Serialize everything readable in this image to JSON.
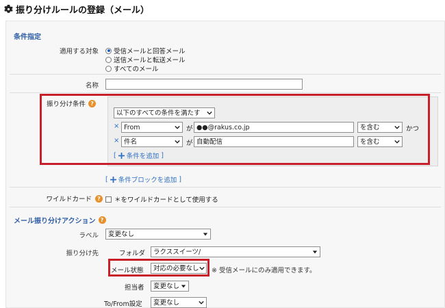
{
  "page": {
    "title": "振り分けルールの登録（メール）"
  },
  "sections": {
    "conditions": "条件指定",
    "actions": "メール振り分けアクション"
  },
  "target": {
    "label": "適用する対象",
    "options": [
      {
        "label": "受信メールと回答メール",
        "selected": true
      },
      {
        "label": "送信メールと転送メール",
        "selected": false
      },
      {
        "label": "すべてのメール",
        "selected": false
      }
    ]
  },
  "name": {
    "label": "名称",
    "value": ""
  },
  "rule": {
    "label": "振り分け条件",
    "match_select": "以下のすべての条件を満たす",
    "rows": [
      {
        "x": "×",
        "field": "From",
        "ga": "が",
        "value": "●●@rakus.co.jp",
        "op": "を含む",
        "join": "かつ"
      },
      {
        "x": "×",
        "field": "件名",
        "ga": "が",
        "value": "自動配信",
        "op": "を含む",
        "join": ""
      }
    ],
    "add_condition": "条件を追加",
    "add_block": "条件ブロックを追加",
    "bracket_open": "[",
    "bracket_close": "]"
  },
  "wildcard": {
    "label": "ワイルドカード",
    "checkbox_label": "＊をワイルドカードとして使用する",
    "checked": false
  },
  "action": {
    "label_label": "ラベル",
    "label_value": "変更なし",
    "dest_label": "振り分け先",
    "folder_label": "フォルダ",
    "folder_value": "ラクススイーツ/",
    "status_label": "メール状態",
    "status_value": "対応の必要なし",
    "status_note": "※ 受信メールにのみ適用できます。",
    "assignee_label": "担当者",
    "assignee_value": "変更なし",
    "tofrom_label": "To/From設定",
    "tofrom_value": "変更なし"
  },
  "colors": {
    "accent": "#2f5fa8",
    "highlight_border": "#c8202a",
    "help_icon": "#e8902a",
    "link": "#2f6fc4"
  },
  "icons": [
    "gear-icon",
    "help-icon",
    "chevron-down-icon",
    "plus-icon",
    "remove-icon"
  ]
}
